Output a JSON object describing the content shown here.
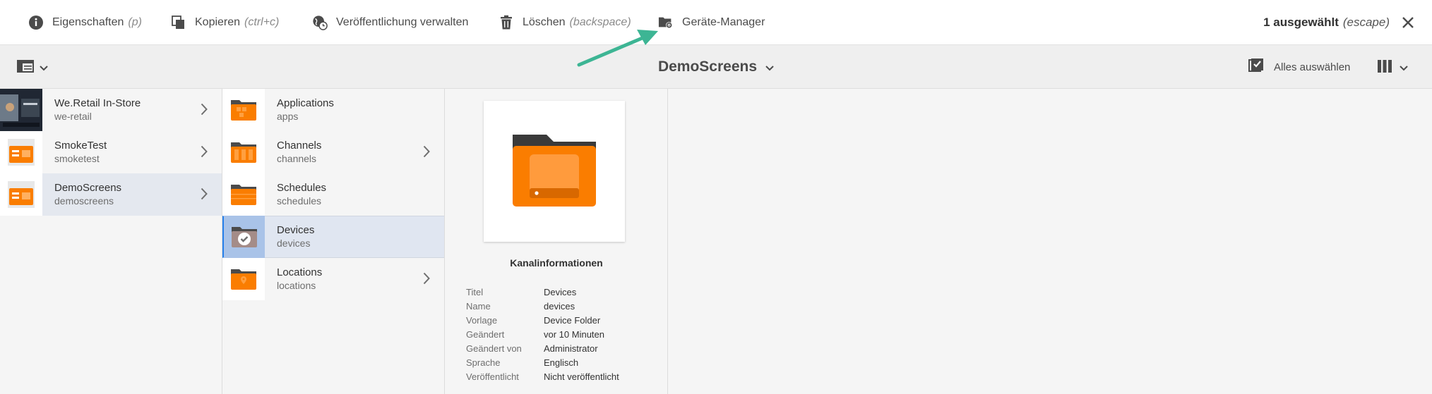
{
  "actionbar": {
    "properties": {
      "label": "Eigenschaften",
      "hint": "(p)"
    },
    "copy": {
      "label": "Kopieren",
      "hint": "(ctrl+c)"
    },
    "publish": {
      "label": "Veröffentlichung verwalten"
    },
    "delete": {
      "label": "Löschen",
      "hint": "(backspace)"
    },
    "devicemanager": {
      "label": "Geräte-Manager"
    },
    "selection": {
      "label": "1 ausgewählt",
      "hint": "(escape)"
    }
  },
  "titlebar": {
    "title": "DemoScreens",
    "select_all": "Alles auswählen"
  },
  "column1": [
    {
      "title": "We.Retail In-Store",
      "name": "we-retail"
    },
    {
      "title": "SmokeTest",
      "name": "smoketest"
    },
    {
      "title": "DemoScreens",
      "name": "demoscreens"
    }
  ],
  "column2": [
    {
      "title": "Applications",
      "name": "apps"
    },
    {
      "title": "Channels",
      "name": "channels"
    },
    {
      "title": "Schedules",
      "name": "schedules"
    },
    {
      "title": "Devices",
      "name": "devices"
    },
    {
      "title": "Locations",
      "name": "locations"
    }
  ],
  "preview": {
    "heading": "Kanalinformationen",
    "fields": [
      {
        "key": "Titel",
        "value": "Devices"
      },
      {
        "key": "Name",
        "value": "devices"
      },
      {
        "key": "Vorlage",
        "value": "Device Folder"
      },
      {
        "key": "Geändert",
        "value": "vor 10 Minuten"
      },
      {
        "key": "Geändert von",
        "value": "Administrator"
      },
      {
        "key": "Sprache",
        "value": "Englisch"
      },
      {
        "key": "Veröffentlicht",
        "value": "Nicht veröffentlicht"
      }
    ]
  },
  "colors": {
    "accent": "#2680eb",
    "folder": "#fa7d00",
    "annotation_arrow": "#3db594"
  }
}
